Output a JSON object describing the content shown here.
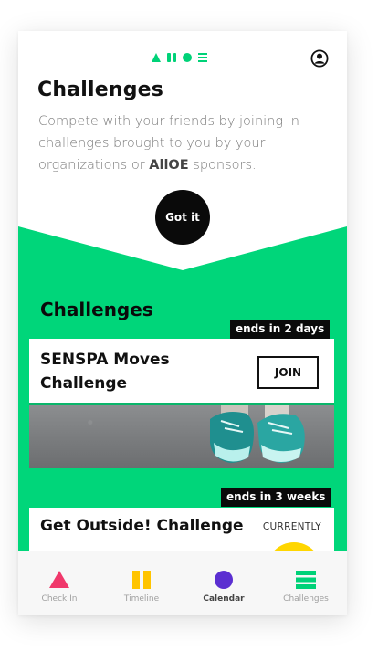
{
  "header": {
    "logo_icons": [
      "triangle-icon",
      "pause-icon",
      "circle-icon",
      "bars-icon"
    ],
    "profile_icon": "user-circle-icon"
  },
  "intro": {
    "title": "Challenges",
    "text_before": "Compete with your friends by joining in challenges brought to you by your organizations or ",
    "brand": "AllOE",
    "text_after": " sponsors.",
    "got_it_label": "Got it"
  },
  "challenges": {
    "section_title": "Challenges",
    "items": [
      {
        "badge": "ends in 2 days",
        "name": "SENSPA Moves Challenge",
        "action_label": "JOIN"
      },
      {
        "badge": "ends in 3 weeks",
        "name": "Get Outside! Challenge",
        "status": "CURRENTLY"
      }
    ]
  },
  "bottom_nav": [
    {
      "label": "Check In",
      "icon": "triangle-icon",
      "color": "#f0386b",
      "active": false
    },
    {
      "label": "Timeline",
      "icon": "pause-icon",
      "color": "#ffc400",
      "active": false
    },
    {
      "label": "Calendar",
      "icon": "circle-icon",
      "color": "#5b2fd1",
      "active": true
    },
    {
      "label": "Challenges",
      "icon": "bars-icon",
      "color": "#00d278",
      "active": false
    }
  ],
  "colors": {
    "accent_green": "#00d67a",
    "dark": "#0a0a0a",
    "yellow": "#ffd600"
  }
}
